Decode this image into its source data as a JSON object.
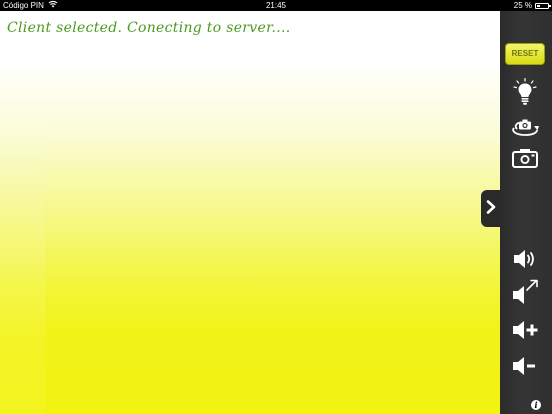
{
  "status_bar": {
    "carrier": "Código PIN",
    "time": "21:45",
    "battery_text": "25 %",
    "battery_level": 0.25,
    "wifi_icon": "wifi-icon",
    "battery_icon": "battery-icon"
  },
  "canvas": {
    "message": "Client selected. Conecting to server....",
    "message_color": "#4a9a1e",
    "gradient_top": "#ffffff",
    "gradient_bottom": "#f2f312"
  },
  "toolbar": {
    "reset_label": "RESET",
    "icons": [
      "lightbulb-icon",
      "rotate-camera-icon",
      "camera-icon",
      "volume-icon",
      "volume-expand-icon",
      "volume-up-icon",
      "volume-down-icon",
      "info-icon"
    ],
    "accent": "#e6e82a",
    "background": "#333333"
  },
  "panel_toggle": {
    "icon": "chevron-right-icon"
  },
  "info_label": "i"
}
